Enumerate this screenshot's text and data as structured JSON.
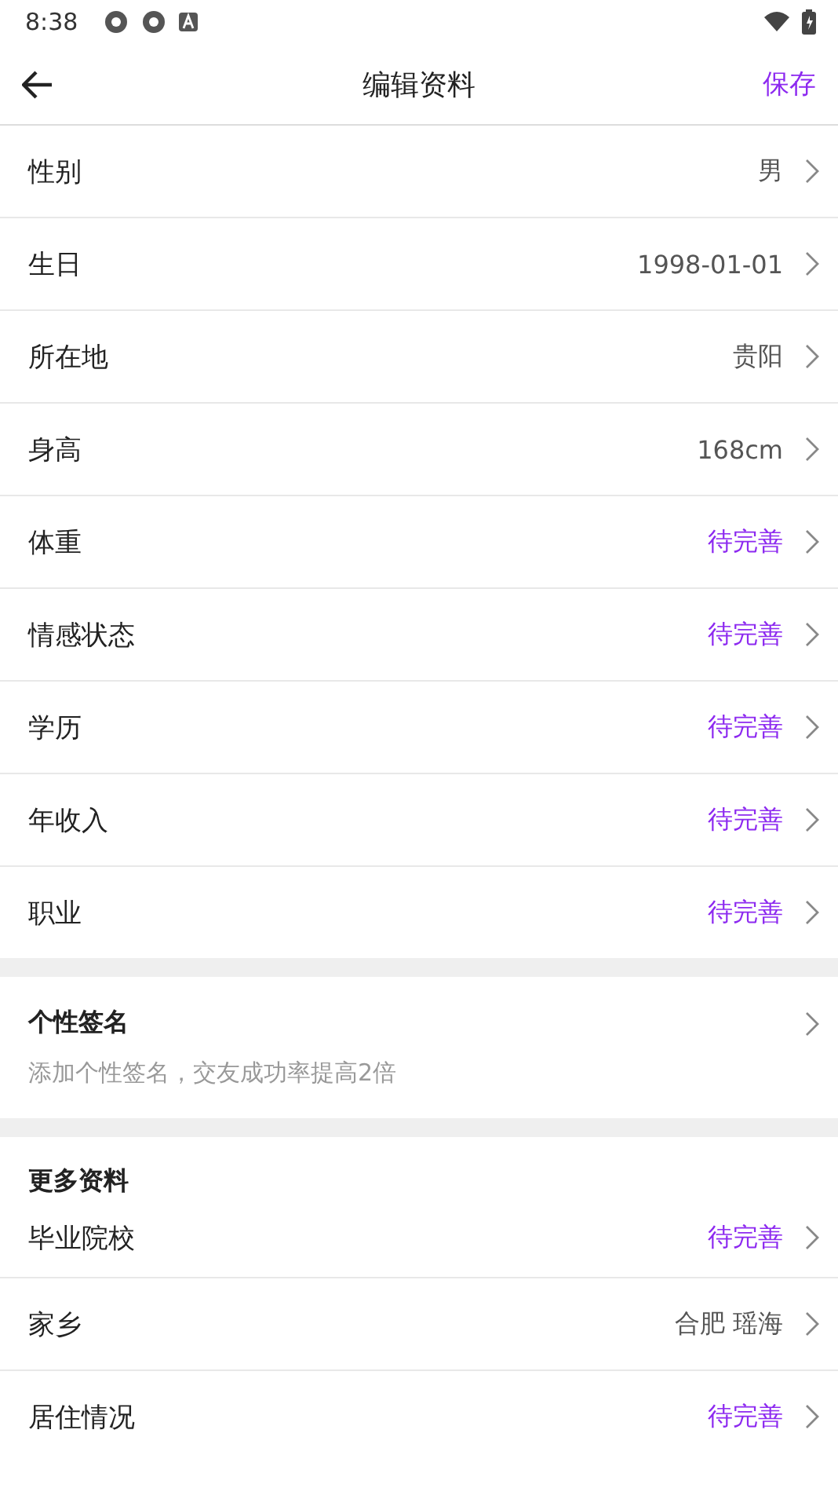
{
  "status_bar": {
    "time": "8:38"
  },
  "header": {
    "title": "编辑资料",
    "action": "保存"
  },
  "basic_rows": [
    {
      "label": "性别",
      "value": "男",
      "pending": false
    },
    {
      "label": "生日",
      "value": "1998-01-01",
      "pending": false
    },
    {
      "label": "所在地",
      "value": "贵阳",
      "pending": false
    },
    {
      "label": "身高",
      "value": "168cm",
      "pending": false
    },
    {
      "label": "体重",
      "value": "待完善",
      "pending": true
    },
    {
      "label": "情感状态",
      "value": "待完善",
      "pending": true
    },
    {
      "label": "学历",
      "value": "待完善",
      "pending": true
    },
    {
      "label": "年收入",
      "value": "待完善",
      "pending": true
    },
    {
      "label": "职业",
      "value": "待完善",
      "pending": true
    }
  ],
  "signature": {
    "title": "个性签名",
    "hint": "添加个性签名，交友成功率提高2倍"
  },
  "more": {
    "title": "更多资料",
    "rows": [
      {
        "label": "毕业院校",
        "value": "待完善",
        "pending": true
      },
      {
        "label": "家乡",
        "value": "合肥 瑶海",
        "pending": false
      },
      {
        "label": "居住情况",
        "value": "待完善",
        "pending": true
      }
    ]
  }
}
